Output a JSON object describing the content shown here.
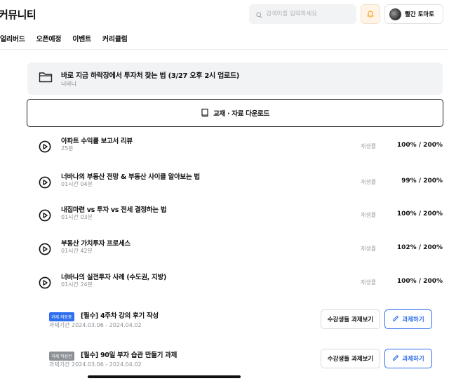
{
  "header": {
    "brand": "커뮤니티",
    "search_placeholder": "검색어를 입력하세요",
    "profile_name": "빨간 토마토"
  },
  "nav": {
    "items": [
      {
        "label": "얼리버드"
      },
      {
        "label": "오픈예정"
      },
      {
        "label": "이벤트"
      },
      {
        "label": "커리큘럼"
      }
    ]
  },
  "folder": {
    "title": "바로 지금 하락장에서 투자처 찾는 법 (3/27 오후 2시 업로드)",
    "subtitle": "너바나"
  },
  "download": {
    "label": "교재 · 자료 다운로드"
  },
  "lessons": [
    {
      "title": "아파트 수익률 보고서 리뷰",
      "duration": "25분",
      "rate_label": "재생률",
      "rate": "100% / 200%"
    },
    {
      "title": "너바나의 부동산 전망 & 부동산 사이클 알아보는 법",
      "duration": "01시간 04분",
      "rate_label": "재생률",
      "rate": "99% / 200%"
    },
    {
      "title": "내집마련 vs 투자 vs 전세 결정하는 법",
      "duration": "01시간 03분",
      "rate_label": "재생률",
      "rate": "100% / 200%"
    },
    {
      "title": "부동산 가치투자 프로세스",
      "duration": "01시간 42분",
      "rate_label": "재생률",
      "rate": "102% / 200%"
    },
    {
      "title": "너바나의 실전투자 사례 (수도권, 지방)",
      "duration": "01시간 24분",
      "rate_label": "재생률",
      "rate": "100% / 200%"
    }
  ],
  "assignments": [
    {
      "badge": "과제 저장중",
      "badge_color": "#2f6fed",
      "title": "[필수] 4주차 강의 후기 작성",
      "period": "과제기간 2024.03.06 - 2024.04.02",
      "view_label": "수강생들 과제보기",
      "do_label": "과제하기"
    },
    {
      "badge": "과제 작성전",
      "badge_color": "#8d9196",
      "title": "[필수] 90일 부자 습관 만들기 과제",
      "period": "과제기간 2024.03.06 - 2024.04.02",
      "view_label": "수강생들 과제보기",
      "do_label": "과제하기"
    }
  ],
  "icons": {
    "search": "search-icon",
    "notification": "bell-icon",
    "folder": "folder-icon",
    "book": "book-icon",
    "play": "play-circle-icon",
    "pencil": "pencil-icon"
  },
  "colors": {
    "accent": "#2f6fed",
    "notif": "#f5a623"
  }
}
